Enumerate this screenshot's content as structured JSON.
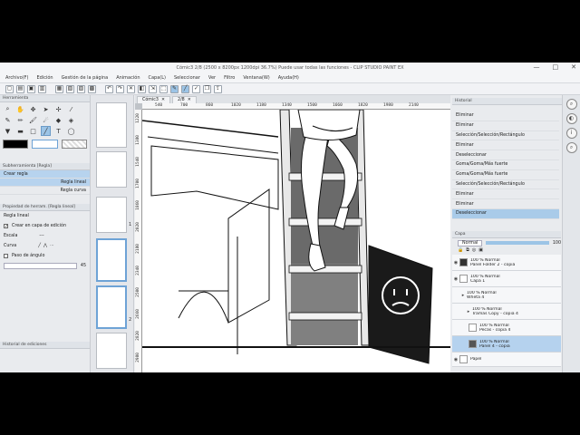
{
  "window": {
    "title": "Cómic3 2/8 (2500 x 8200px 1200dpi 36.7%)  Puede usar todas las funciones  - CLIP STUDIO PAINT EX",
    "controls": [
      "—",
      "□",
      "✕"
    ]
  },
  "menu": [
    "Archivo(F)",
    "Edición",
    "Gestión de la página",
    "Animación",
    "Capa(L)",
    "Seleccionar",
    "Ver",
    "Filtro",
    "Ventana(W)",
    "Ayuda(H)"
  ],
  "toolbar_icons": [
    "new-icon",
    "open-icon",
    "save-icon",
    "folder-icon",
    "page-icon",
    "page2-icon",
    "page3-icon",
    "page4-icon",
    "undo-icon",
    "redo-icon",
    "clear-icon",
    "fill-icon",
    "transform-icon",
    "selection-icon",
    "pen-icon",
    "line-icon",
    "check-icon",
    "layer-icon",
    "export-icon"
  ],
  "tool_panel": {
    "title": "Herramienta",
    "subtool_title": "Subherramienta [Regla]",
    "subtool_items": [
      {
        "label": "Crear regla",
        "selected": true
      },
      {
        "label": "Regla lineal",
        "selected": true
      },
      {
        "label": "Regla curva",
        "selected": false
      }
    ],
    "props_title": "Propiedad de herram. [Regla lineal]",
    "props_name": "Regla lineal",
    "props": {
      "create_on_layer": "Crear en capa de edición",
      "snap": "Escala",
      "snap_value": "---",
      "curve": "Curva",
      "angle_step": "Paso de ángulo",
      "angle_value": "45"
    },
    "history_tab": "Historial de ediciones"
  },
  "navigator": {
    "page_numbers": [
      "1",
      "2"
    ]
  },
  "canvas": {
    "tabs": [
      {
        "label": "Cómic3"
      },
      {
        "label": "2/8"
      }
    ],
    "ruler_h": [
      "540",
      "700",
      "860",
      "1020",
      "1180",
      "1340",
      "1500",
      "1660",
      "1820",
      "1980",
      "2140"
    ],
    "ruler_v": [
      "1220",
      "1380",
      "1540",
      "1700",
      "1860",
      "2020",
      "2180",
      "2340",
      "2500",
      "2660",
      "2820",
      "2980"
    ]
  },
  "history": {
    "title": "Historial",
    "items": [
      {
        "label": "Eliminar",
        "selected": false
      },
      {
        "label": "Eliminar",
        "selected": false
      },
      {
        "label": "Selección/Selección/Rectángulo",
        "selected": false
      },
      {
        "label": "Eliminar",
        "selected": false
      },
      {
        "label": "Deseleccionar",
        "selected": false
      },
      {
        "label": "Goma/Goma/Más fuerte",
        "selected": false
      },
      {
        "label": "Goma/Goma/Más fuerte",
        "selected": false
      },
      {
        "label": "Selección/Selección/Rectángulo",
        "selected": false
      },
      {
        "label": "Eliminar",
        "selected": false
      },
      {
        "label": "Eliminar",
        "selected": false
      },
      {
        "label": "Deseleccionar",
        "selected": true
      }
    ]
  },
  "layers": {
    "title": "Capa",
    "blend_mode": "Normal",
    "opacity": "100",
    "items": [
      {
        "label": "100 % Normal",
        "sub": "Panel Folder 2 - copia",
        "selected": false
      },
      {
        "label": "100 % Normal",
        "sub": "Capa 1",
        "selected": false
      },
      {
        "label": "100 % Normal",
        "sub": "Wheta 4",
        "selected": false
      },
      {
        "label": "100 % Normal",
        "sub": "Tramas Copy - copia 4",
        "selected": false
      },
      {
        "label": "100 % Normal",
        "sub": "Pecas - copia 4",
        "selected": false
      },
      {
        "label": "100 % Normal",
        "sub": "Panel 4 - copia",
        "selected": true
      },
      {
        "label": "Papel",
        "sub": "",
        "selected": false
      }
    ]
  },
  "colors": {
    "accent": "#9cc4e6",
    "selection": "#b5d2ee",
    "panel_bg": "#e9ebee"
  }
}
